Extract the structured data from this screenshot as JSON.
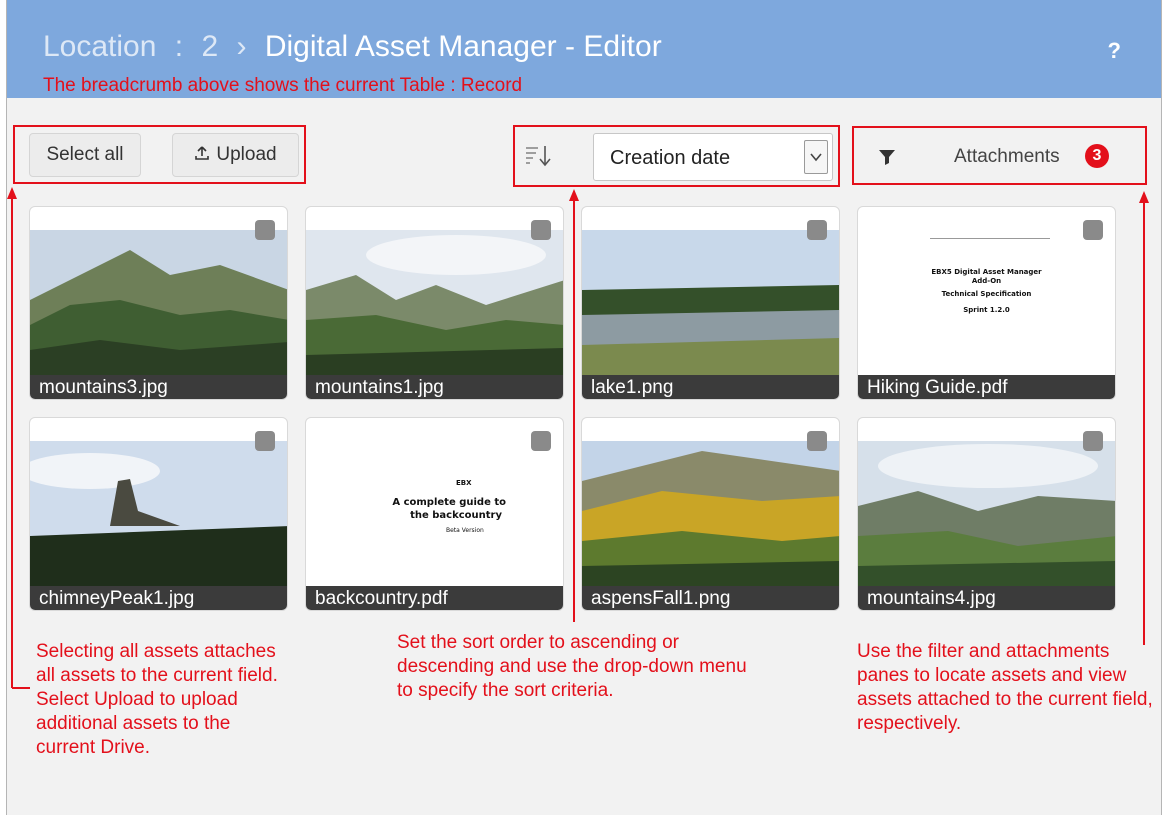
{
  "header": {
    "table": "Location",
    "separator": ":",
    "record": "2",
    "chevron": "›",
    "title": "Digital Asset Manager - Editor",
    "help_label": "?",
    "annotation": "The breadcrumb above shows the current Table : Record"
  },
  "toolbar": {
    "select_all_label": "Select all",
    "upload_icon": "upload-icon",
    "upload_label": "Upload",
    "sort_icon": "sort-order-icon",
    "sort_value": "Creation date",
    "filter_icon": "filter-icon",
    "attachments_label": "Attachments",
    "attachments_count": "3"
  },
  "assets": [
    {
      "name": "mountains3.jpg",
      "kind": "image"
    },
    {
      "name": "mountains1.jpg",
      "kind": "image"
    },
    {
      "name": "lake1.png",
      "kind": "image"
    },
    {
      "name": "Hiking Guide.pdf",
      "kind": "pdf",
      "doc_lines": [
        "EBX5 Digital Asset Manager",
        "Add-On",
        "Technical Specification",
        "Sprint 1.2.0"
      ]
    },
    {
      "name": "chimneyPeak1.jpg",
      "kind": "image"
    },
    {
      "name": "backcountry.pdf",
      "kind": "pdf",
      "doc_lines": [
        "EBX",
        "A complete guide to",
        "the backcountry",
        "Beta Version"
      ]
    },
    {
      "name": "aspensFall1.png",
      "kind": "image"
    },
    {
      "name": "mountains4.jpg",
      "kind": "image"
    }
  ],
  "notes": {
    "left": "Selecting all assets attaches all assets to the current field. Select Upload to upload additional assets to the current Drive.",
    "middle": "Set the sort order to ascending or descending and use the drop-down menu to specify the sort criteria.",
    "right": "Use the filter and attachments panes to locate assets and view assets attached to the current field, respectively."
  },
  "colors": {
    "header_bg": "#7ea8dd",
    "annotation_red": "#e3101b",
    "caption_bg": "#3b3b3b",
    "panel_bg": "#f2f2f2"
  }
}
